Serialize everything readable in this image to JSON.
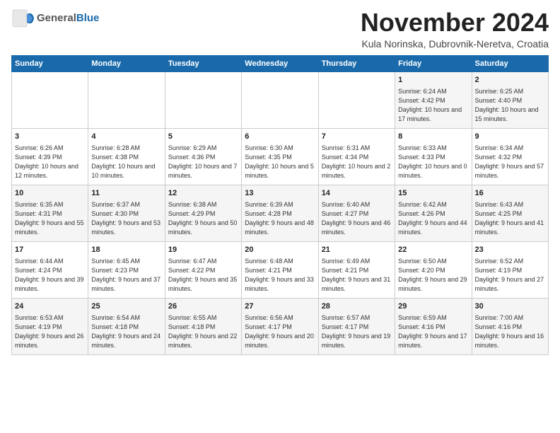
{
  "header": {
    "logo_general": "General",
    "logo_blue": "Blue",
    "month": "November 2024",
    "location": "Kula Norinska, Dubrovnik-Neretva, Croatia"
  },
  "days_of_week": [
    "Sunday",
    "Monday",
    "Tuesday",
    "Wednesday",
    "Thursday",
    "Friday",
    "Saturday"
  ],
  "weeks": [
    {
      "days": [
        {
          "num": "",
          "info": ""
        },
        {
          "num": "",
          "info": ""
        },
        {
          "num": "",
          "info": ""
        },
        {
          "num": "",
          "info": ""
        },
        {
          "num": "",
          "info": ""
        },
        {
          "num": "1",
          "info": "Sunrise: 6:24 AM\nSunset: 4:42 PM\nDaylight: 10 hours and 17 minutes."
        },
        {
          "num": "2",
          "info": "Sunrise: 6:25 AM\nSunset: 4:40 PM\nDaylight: 10 hours and 15 minutes."
        }
      ]
    },
    {
      "days": [
        {
          "num": "3",
          "info": "Sunrise: 6:26 AM\nSunset: 4:39 PM\nDaylight: 10 hours and 12 minutes."
        },
        {
          "num": "4",
          "info": "Sunrise: 6:28 AM\nSunset: 4:38 PM\nDaylight: 10 hours and 10 minutes."
        },
        {
          "num": "5",
          "info": "Sunrise: 6:29 AM\nSunset: 4:36 PM\nDaylight: 10 hours and 7 minutes."
        },
        {
          "num": "6",
          "info": "Sunrise: 6:30 AM\nSunset: 4:35 PM\nDaylight: 10 hours and 5 minutes."
        },
        {
          "num": "7",
          "info": "Sunrise: 6:31 AM\nSunset: 4:34 PM\nDaylight: 10 hours and 2 minutes."
        },
        {
          "num": "8",
          "info": "Sunrise: 6:33 AM\nSunset: 4:33 PM\nDaylight: 10 hours and 0 minutes."
        },
        {
          "num": "9",
          "info": "Sunrise: 6:34 AM\nSunset: 4:32 PM\nDaylight: 9 hours and 57 minutes."
        }
      ]
    },
    {
      "days": [
        {
          "num": "10",
          "info": "Sunrise: 6:35 AM\nSunset: 4:31 PM\nDaylight: 9 hours and 55 minutes."
        },
        {
          "num": "11",
          "info": "Sunrise: 6:37 AM\nSunset: 4:30 PM\nDaylight: 9 hours and 53 minutes."
        },
        {
          "num": "12",
          "info": "Sunrise: 6:38 AM\nSunset: 4:29 PM\nDaylight: 9 hours and 50 minutes."
        },
        {
          "num": "13",
          "info": "Sunrise: 6:39 AM\nSunset: 4:28 PM\nDaylight: 9 hours and 48 minutes."
        },
        {
          "num": "14",
          "info": "Sunrise: 6:40 AM\nSunset: 4:27 PM\nDaylight: 9 hours and 46 minutes."
        },
        {
          "num": "15",
          "info": "Sunrise: 6:42 AM\nSunset: 4:26 PM\nDaylight: 9 hours and 44 minutes."
        },
        {
          "num": "16",
          "info": "Sunrise: 6:43 AM\nSunset: 4:25 PM\nDaylight: 9 hours and 41 minutes."
        }
      ]
    },
    {
      "days": [
        {
          "num": "17",
          "info": "Sunrise: 6:44 AM\nSunset: 4:24 PM\nDaylight: 9 hours and 39 minutes."
        },
        {
          "num": "18",
          "info": "Sunrise: 6:45 AM\nSunset: 4:23 PM\nDaylight: 9 hours and 37 minutes."
        },
        {
          "num": "19",
          "info": "Sunrise: 6:47 AM\nSunset: 4:22 PM\nDaylight: 9 hours and 35 minutes."
        },
        {
          "num": "20",
          "info": "Sunrise: 6:48 AM\nSunset: 4:21 PM\nDaylight: 9 hours and 33 minutes."
        },
        {
          "num": "21",
          "info": "Sunrise: 6:49 AM\nSunset: 4:21 PM\nDaylight: 9 hours and 31 minutes."
        },
        {
          "num": "22",
          "info": "Sunrise: 6:50 AM\nSunset: 4:20 PM\nDaylight: 9 hours and 29 minutes."
        },
        {
          "num": "23",
          "info": "Sunrise: 6:52 AM\nSunset: 4:19 PM\nDaylight: 9 hours and 27 minutes."
        }
      ]
    },
    {
      "days": [
        {
          "num": "24",
          "info": "Sunrise: 6:53 AM\nSunset: 4:19 PM\nDaylight: 9 hours and 26 minutes."
        },
        {
          "num": "25",
          "info": "Sunrise: 6:54 AM\nSunset: 4:18 PM\nDaylight: 9 hours and 24 minutes."
        },
        {
          "num": "26",
          "info": "Sunrise: 6:55 AM\nSunset: 4:18 PM\nDaylight: 9 hours and 22 minutes."
        },
        {
          "num": "27",
          "info": "Sunrise: 6:56 AM\nSunset: 4:17 PM\nDaylight: 9 hours and 20 minutes."
        },
        {
          "num": "28",
          "info": "Sunrise: 6:57 AM\nSunset: 4:17 PM\nDaylight: 9 hours and 19 minutes."
        },
        {
          "num": "29",
          "info": "Sunrise: 6:59 AM\nSunset: 4:16 PM\nDaylight: 9 hours and 17 minutes."
        },
        {
          "num": "30",
          "info": "Sunrise: 7:00 AM\nSunset: 4:16 PM\nDaylight: 9 hours and 16 minutes."
        }
      ]
    }
  ]
}
